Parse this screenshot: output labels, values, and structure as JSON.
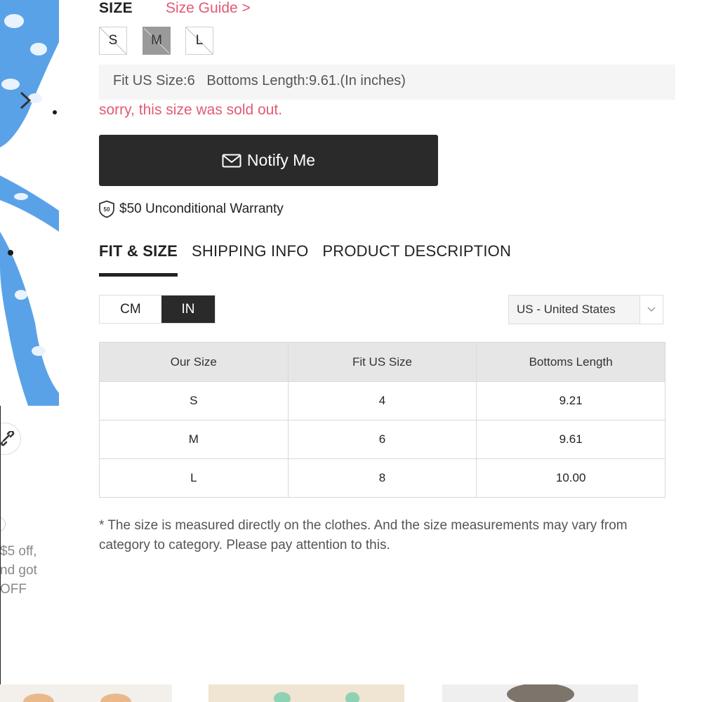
{
  "gallery": {
    "next_icon": "chevron-right-icon",
    "share_icon": "link-icon",
    "promo_lines": [
      "$5 off,",
      "nd got",
      "OFF"
    ]
  },
  "size": {
    "heading": "SIZE",
    "guide_link": "Size Guide >",
    "options": [
      {
        "label": "S",
        "selected": false,
        "sold_out": true
      },
      {
        "label": "M",
        "selected": true,
        "sold_out": true
      },
      {
        "label": "L",
        "selected": false,
        "sold_out": true
      }
    ],
    "fit_info": "Fit US Size:6   Bottoms Length:9.61.(In inches)",
    "sold_out_message": "sorry, this size was sold out."
  },
  "notify": {
    "label": "Notify Me",
    "icon": "envelope-icon"
  },
  "warranty": {
    "badge_text": "50",
    "label": "$50 Unconditional Warranty",
    "icon": "shield-icon"
  },
  "tabs": [
    {
      "label": "FIT & SIZE",
      "active": true
    },
    {
      "label": "SHIPPING INFO",
      "active": false
    },
    {
      "label": "PRODUCT DESCRIPTION",
      "active": false
    }
  ],
  "units": {
    "options": [
      "CM",
      "IN"
    ],
    "selected": "IN"
  },
  "region": {
    "selected": "US - United States",
    "icon": "chevron-down-icon"
  },
  "size_table": {
    "headers": [
      "Our Size",
      "Fit US Size",
      "Bottoms Length"
    ],
    "rows": [
      [
        "S",
        "4",
        "9.21"
      ],
      [
        "M",
        "6",
        "9.61"
      ],
      [
        "L",
        "8",
        "10.00"
      ]
    ]
  },
  "note": "* The size is measured directly on the clothes. And the size measurements may vary from category to category. Please pay attention to this.",
  "colors": {
    "accent_pink": "#e35a73",
    "dark_button": "#2a2a2a",
    "table_header_bg": "#e6e6e6",
    "info_bg": "#f5f5f5"
  }
}
